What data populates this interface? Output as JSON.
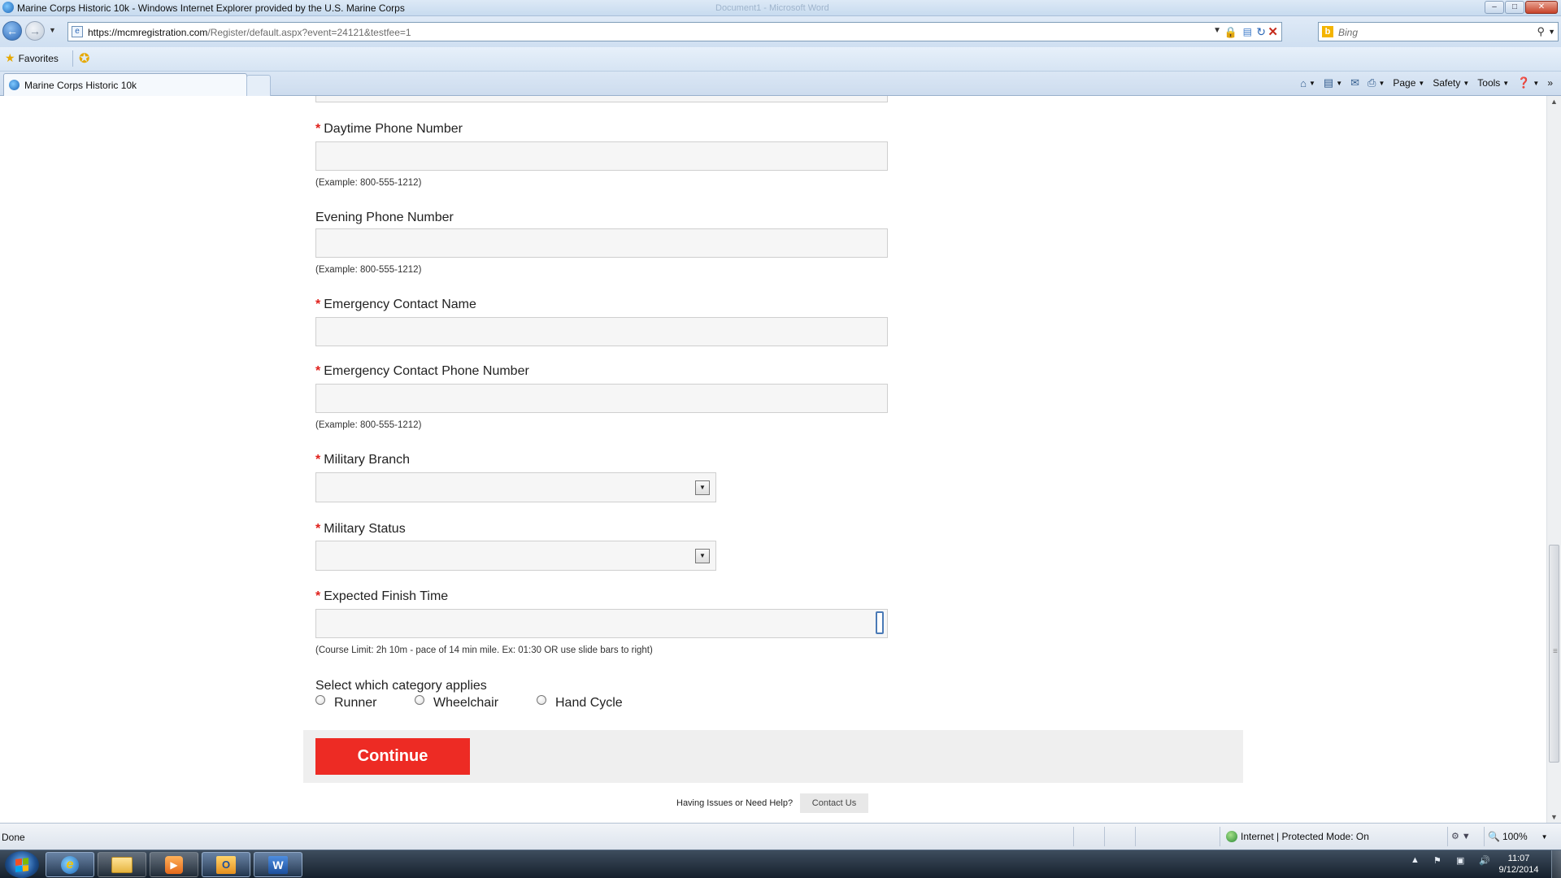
{
  "window": {
    "title": "Marine Corps Historic 10k - Windows Internet Explorer provided by the U.S. Marine Corps",
    "ghost_title": "Document1 - Microsoft Word",
    "minimize": "–",
    "maximize": "□",
    "close": "✕"
  },
  "address_bar": {
    "url_host": "https://mcmregistration.com",
    "url_path": "/Register/default.aspx?event=24121&testfee=1"
  },
  "search": {
    "placeholder": "Bing"
  },
  "favorites": {
    "label": "Favorites"
  },
  "tab": {
    "label": "Marine Corps Historic 10k"
  },
  "command_bar": {
    "page": "Page",
    "safety": "Safety",
    "tools": "Tools"
  },
  "form": {
    "daytime_phone": {
      "label": "Daytime Phone Number",
      "hint": "(Example: 800-555-1212)",
      "required": "*"
    },
    "evening_phone": {
      "label": "Evening Phone Number",
      "hint": "(Example: 800-555-1212)"
    },
    "emergency_name": {
      "label": "Emergency Contact Name",
      "required": "*"
    },
    "emergency_phone": {
      "label": "Emergency Contact Phone Number",
      "hint": "(Example: 800-555-1212)",
      "required": "*"
    },
    "military_branch": {
      "label": "Military Branch",
      "required": "*"
    },
    "military_status": {
      "label": "Military Status",
      "required": "*"
    },
    "finish_time": {
      "label": "Expected Finish Time",
      "hint": "(Course Limit: 2h 10m - pace of 14 min mile. Ex: 01:30 OR use slide bars to right)",
      "required": "*"
    },
    "category": {
      "label": "Select which category applies",
      "options": [
        "Runner",
        "Wheelchair",
        "Hand Cycle"
      ]
    },
    "continue_label": "Continue"
  },
  "help": {
    "text": "Having Issues or Need Help?",
    "contact_label": "Contact Us"
  },
  "status_bar": {
    "status": "Done",
    "zone": "Internet | Protected Mode: On",
    "zoom": "100%"
  },
  "taskbar": {
    "time": "11:07",
    "date": "9/12/2014"
  }
}
